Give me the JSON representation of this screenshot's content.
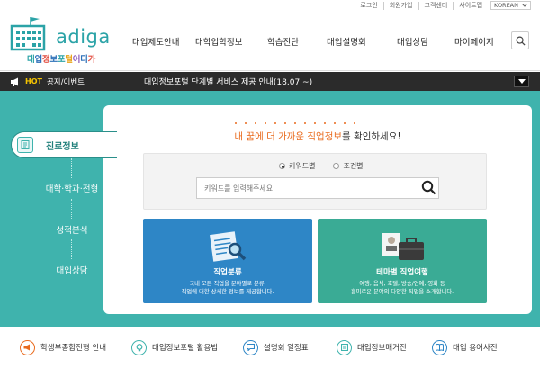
{
  "util_bar": {
    "links": [
      "로그인",
      "회원가입",
      "고객센터",
      "사이트맵"
    ],
    "language": "KOREAN"
  },
  "logo": {
    "wordmark": "adiga",
    "subtitle_chars": [
      {
        "ch": "대",
        "color": "#2ba3a7"
      },
      {
        "ch": "입",
        "color": "#2b6fb8"
      },
      {
        "ch": "정",
        "color": "#e24c3f"
      },
      {
        "ch": "보",
        "color": "#2b6fb8"
      },
      {
        "ch": "포",
        "color": "#2ba3a7"
      },
      {
        "ch": "털",
        "color": "#e9a317"
      },
      {
        "ch": "어",
        "color": "#8a58b8"
      },
      {
        "ch": "디",
        "color": "#2b6fb8"
      },
      {
        "ch": "가",
        "color": "#e24c3f"
      }
    ]
  },
  "nav": {
    "items": [
      "대입제도안내",
      "대학입학정보",
      "학습진단",
      "대입설명회",
      "대입상담",
      "마이페이지"
    ]
  },
  "notice": {
    "hot": "HOT",
    "category": "공지/이벤트",
    "text": "대입정보포털 단계별 서비스 제공 안내(18.07 ~)"
  },
  "sidebar": {
    "active": "진로정보",
    "items": [
      "대학·학과·전형",
      "성적분석",
      "대입상담"
    ]
  },
  "content": {
    "headline_highlight": "내 꿈에 더 가까운 직업정보",
    "headline_rest": "를 확인하세요!",
    "radio_keyword": "키워드별",
    "radio_condition": "조건별",
    "search_placeholder": "키워드를 입력해주세요",
    "cards": [
      {
        "title": "직업분류",
        "desc1": "국내 모든 직업을 분야별로 분류,",
        "desc2": "직업에 대한 상세한 정보를 제공합니다."
      },
      {
        "title": "테마별 직업여행",
        "desc1": "여행, 음식, 호텔, 방송/연예, 영화 등",
        "desc2": "흥미로운 분야의 다양한 직업을 소개합니다."
      }
    ]
  },
  "quick_links": [
    {
      "label": "학생부종합전형 안내",
      "icon": "megaphone-icon",
      "color": "#e96b1e"
    },
    {
      "label": "대입정보포털 활용법",
      "icon": "lightbulb-icon",
      "color": "#3fb3ad"
    },
    {
      "label": "설명회 일정표",
      "icon": "chat-icon",
      "color": "#2e86c6"
    },
    {
      "label": "대입정보매거진",
      "icon": "magazine-icon",
      "color": "#3fb3ad"
    },
    {
      "label": "대입 용어사전",
      "icon": "book-icon",
      "color": "#2e86c6"
    }
  ],
  "colors": {
    "teal": "#3fb3ad",
    "orange": "#e96b1e",
    "blue": "#2e86c6",
    "dark_bar": "#2b2b2b"
  }
}
